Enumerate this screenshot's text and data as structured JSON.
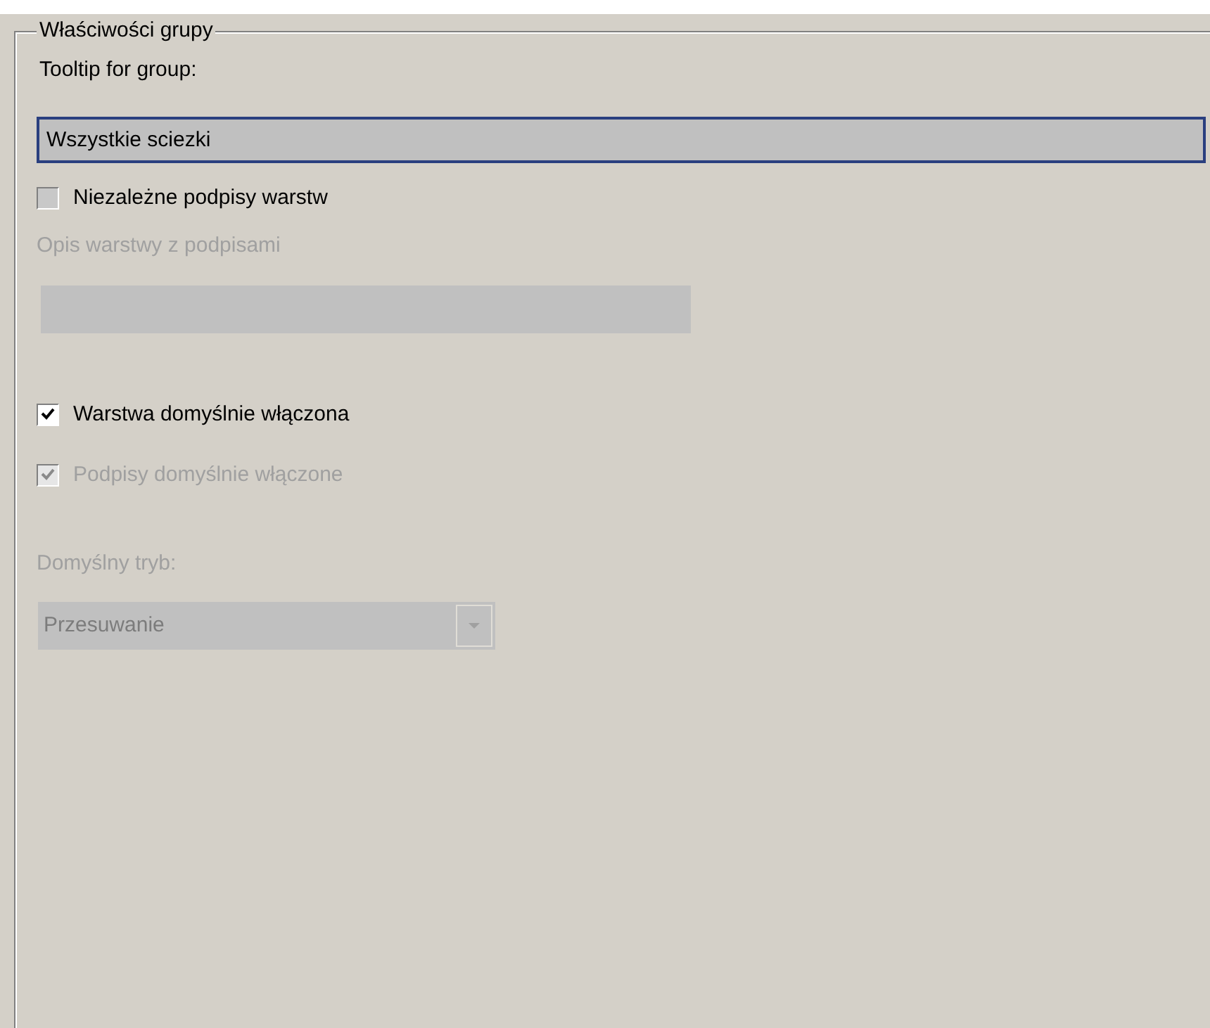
{
  "group": {
    "title": "Właściwości grupy"
  },
  "tooltip": {
    "label": "Tooltip for group:",
    "value": "Wszystkie sciezki",
    "focused": true
  },
  "independent_labels": {
    "label": "Niezależne podpisy warstw",
    "checked": false,
    "disabled": false
  },
  "description": {
    "label": "Opis warstwy z podpisami",
    "disabled": true
  },
  "layer_on": {
    "label": "Warstwa domyślnie włączona",
    "checked": true,
    "disabled": false
  },
  "labels_on": {
    "label": "Podpisy domyślnie włączone",
    "checked": true,
    "disabled": true
  },
  "mode": {
    "label": "Domyślny tryb:",
    "value": "Przesuwanie",
    "disabled": true
  }
}
